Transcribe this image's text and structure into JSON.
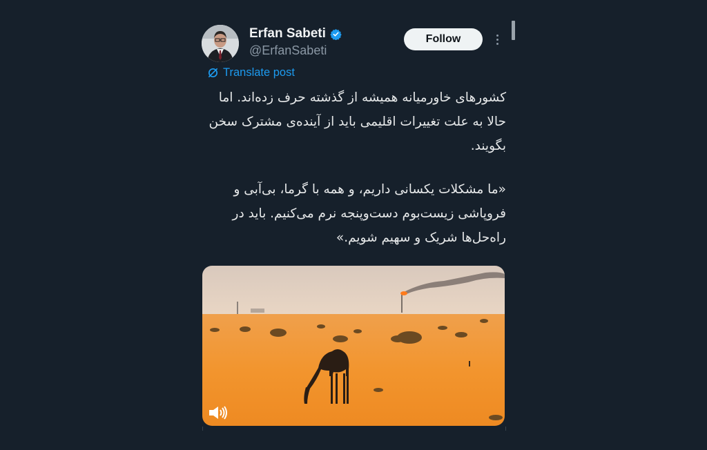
{
  "author": {
    "name": "Erfan Sabeti",
    "handle": "@ErfanSabeti",
    "verified": true,
    "avatar_icon": "profile-photo"
  },
  "actions": {
    "follow_label": "Follow",
    "more_icon": "more-vertical-icon"
  },
  "translate": {
    "label": "Translate post",
    "icon": "translate-icon"
  },
  "post": {
    "paragraph_1": "کشورهای خاورمیانه همیشه از گذشته حرف زده‌اند. اما حالا به علت تغییرات اقلیمی باید از آینده‌ی مشترک سخن بگویند.",
    "paragraph_2": "«ما مشکلات یکسانی داریم، و همه با گرما، بی‌آبی و فروپاشی زیست‌بوم دست‌وپنجه نرم می‌کنیم. باید در راه‌حل‌ها شریک و سهیم شویم.»"
  },
  "media": {
    "type": "video",
    "scene": "camel in orange desert with gas flare",
    "volume_icon": "volume-icon"
  },
  "colors": {
    "background": "#16202b",
    "accent": "#1d9bf0",
    "text": "#e7e9ea",
    "secondary": "#8b98a5"
  }
}
